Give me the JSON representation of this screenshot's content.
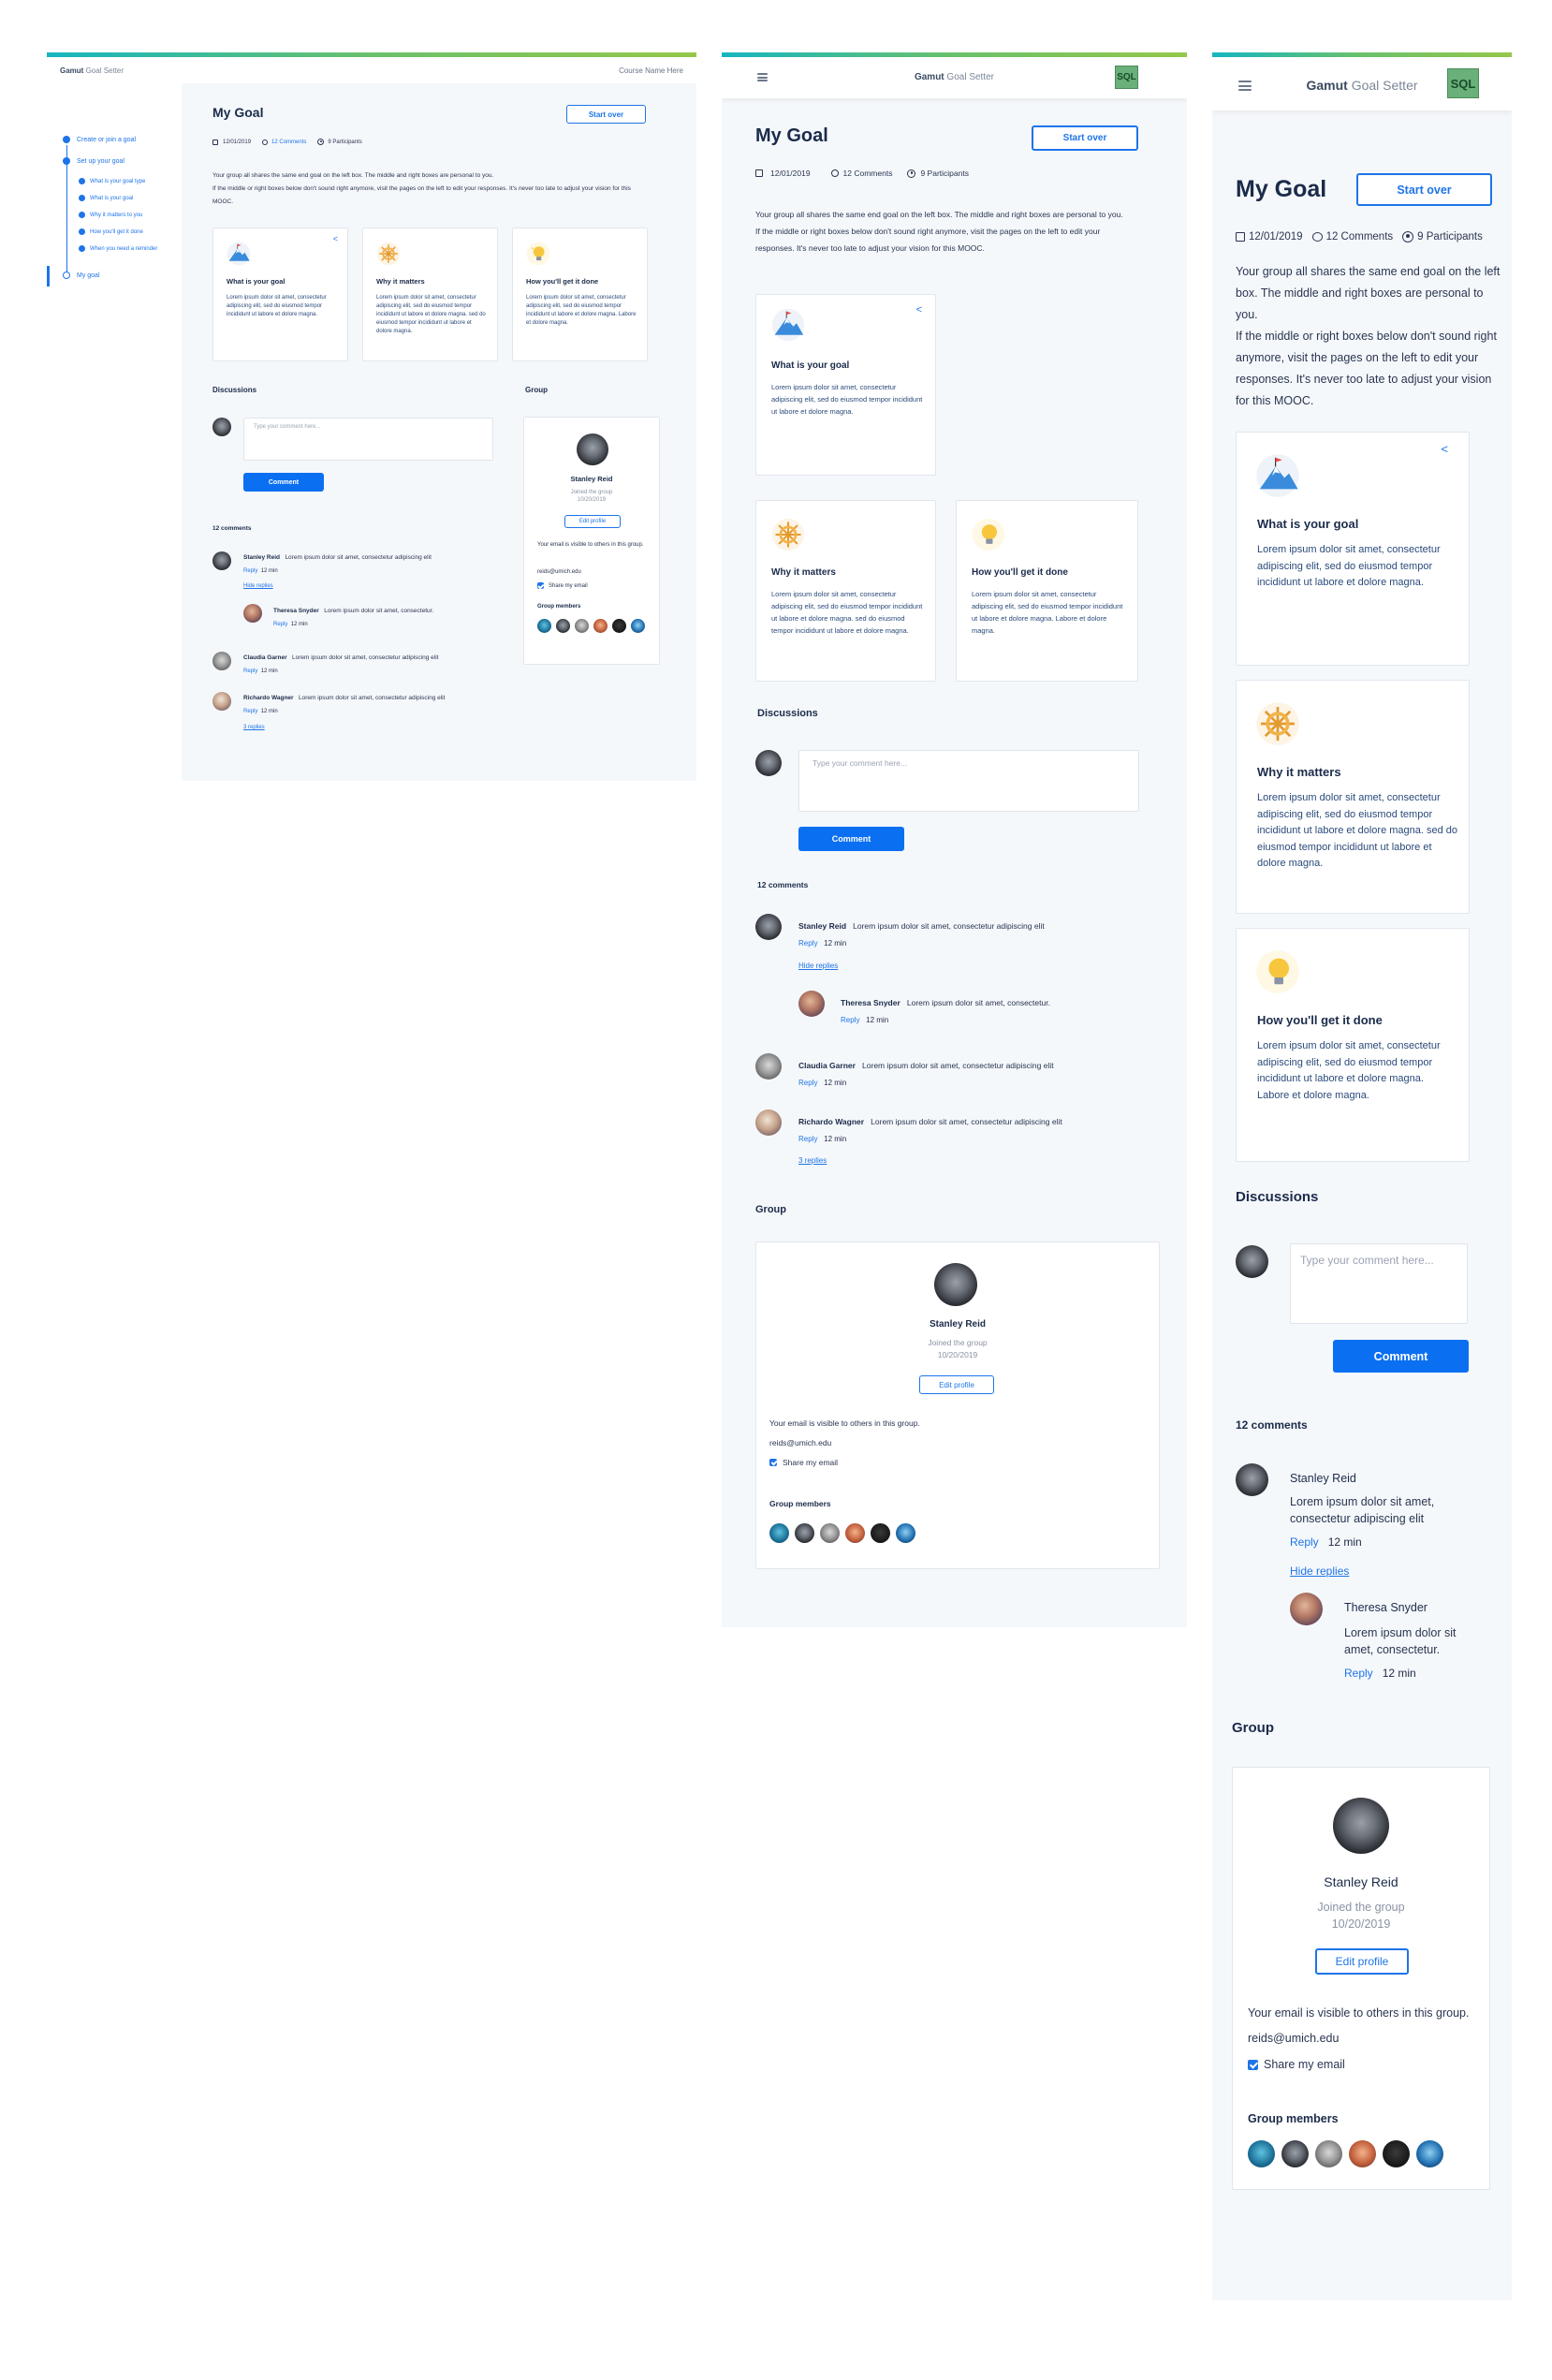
{
  "app": {
    "brand": "Gamut",
    "product": "Goal Setter",
    "course": "Course Name Here",
    "logo_text": "SQL"
  },
  "sidebar": {
    "items": [
      {
        "label": "Create or join a goal"
      },
      {
        "label": "Set up your goal"
      },
      {
        "label": "What is your goal type"
      },
      {
        "label": "What is your goal"
      },
      {
        "label": "Why it matters to you"
      },
      {
        "label": "How you'll get it done"
      },
      {
        "label": "When you need a reminder"
      },
      {
        "label": "My goal"
      }
    ]
  },
  "page": {
    "title": "My Goal",
    "start_over": "Start over",
    "date": "12/01/2019",
    "comments_count": "12 Comments",
    "participants": "9 Participants",
    "description_1": "Your group all shares the same end goal on the left box. The middle and right boxes are personal to you.",
    "description_2": "If the middle or right boxes below don't sound right anymore, visit the pages on the left to edit your responses. It's never too late to adjust your vision for this MOOC."
  },
  "cards": [
    {
      "title": "What is your goal",
      "body": "Lorem ipsum dolor sit amet, consectetur adipiscing elit, sed do eiusmod tempor incididunt ut labore et dolore magna.",
      "icon": "mountain-flag-icon"
    },
    {
      "title": "Why it matters",
      "body": "Lorem ipsum dolor sit amet, consectetur adipiscing elit, sed do eiusmod tempor incididunt ut labore et dolore magna. sed do eiusmod tempor incididunt ut labore et dolore magna.",
      "icon": "ship-wheel-icon"
    },
    {
      "title": "How you'll get it done",
      "body": "Lorem ipsum dolor sit amet, consectetur adipiscing elit, sed do eiusmod tempor incididunt ut labore et dolore magna. Labore et dolore magna.",
      "icon": "lightbulb-icon"
    }
  ],
  "discussions": {
    "heading": "Discussions",
    "placeholder": "Type your comment here...",
    "comment_button": "Comment",
    "count_label": "12 comments",
    "comments": [
      {
        "name": "Stanley Reid",
        "text": "Lorem ipsum dolor sit amet, consectetur adipiscing elit",
        "reply": "Reply",
        "time": "12 min",
        "toggle": "Hide replies"
      },
      {
        "name": "Theresa Snyder",
        "text": "Lorem ipsum dolor sit amet, consectetur.",
        "reply": "Reply",
        "time": "12 min"
      },
      {
        "name": "Claudia Garner",
        "text": "Lorem ipsum dolor sit amet, consectetur adipiscing elit",
        "reply": "Reply",
        "time": "12 min"
      },
      {
        "name": "Richardo Wagner",
        "text": "Lorem ipsum dolor sit amet, consectetur adipiscing elit",
        "reply": "Reply",
        "time": "12 min",
        "toggle": "3 replies"
      }
    ]
  },
  "group": {
    "heading": "Group",
    "name": "Stanley Reid",
    "joined_1": "Joined the group",
    "joined_2": "10/20/2019",
    "edit": "Edit profile",
    "visibility": "Your email is visible to others in this group.",
    "email": "reids@umich.edu",
    "share": "Share my email",
    "members_label": "Group members"
  },
  "colors": {
    "accent": "#1e74e8",
    "primary_button": "#0b6ff2",
    "page_bg": "#f5f8fb",
    "gradient_start": "#16b7c3",
    "gradient_end": "#95c94a"
  }
}
